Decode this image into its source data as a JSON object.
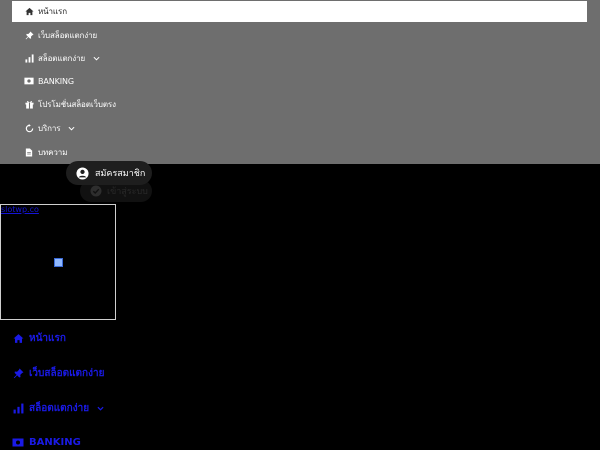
{
  "menu": {
    "items": [
      {
        "label": "หน้าแรก",
        "icon": "home-icon",
        "has_chevron": false
      },
      {
        "label": "เว็บสล็อตแตกง่าย",
        "icon": "pin-icon",
        "has_chevron": false
      },
      {
        "label": "สล็อตแตกง่าย",
        "icon": "bar-chart-icon",
        "has_chevron": true
      },
      {
        "label": "BANKING",
        "icon": "money-icon",
        "has_chevron": false
      },
      {
        "label": "โปรโมชั่นสล็อตเว็บตรง",
        "icon": "gift-icon",
        "has_chevron": false
      },
      {
        "label": "บริการ",
        "icon": "refresh-icon",
        "has_chevron": true
      },
      {
        "label": "บทความ",
        "icon": "document-icon",
        "has_chevron": false
      }
    ]
  },
  "auth": {
    "register_label": "สมัครสมาชิก",
    "login_label": "เข้าสู่ระบบ"
  },
  "logo": {
    "alt_text": "slotwp.co"
  },
  "lower_menu": {
    "items": [
      {
        "label": "หน้าแรก",
        "icon": "home-icon"
      },
      {
        "label": "เว็บสล็อตแตกง่าย",
        "icon": "pin-icon"
      },
      {
        "label": "สล็อตแตกง่าย",
        "icon": "bar-chart-icon"
      },
      {
        "label": "BANKING",
        "icon": "money-icon"
      }
    ]
  },
  "colors": {
    "menu_bg": "#6e6e6e",
    "page_bg": "#000000",
    "link_blue": "#1a1ae6"
  }
}
